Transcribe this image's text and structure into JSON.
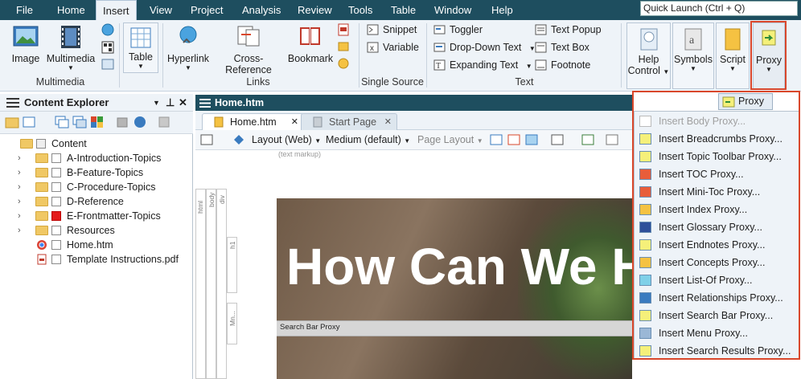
{
  "menubar": {
    "items": [
      "File",
      "Home",
      "Insert",
      "View",
      "Project",
      "Analysis",
      "Review",
      "Tools",
      "Table",
      "Window",
      "Help"
    ],
    "active": "Insert",
    "quick_launch": "Quick Launch (Ctrl + Q)"
  },
  "ribbon": {
    "multimedia_group": {
      "image": "Image",
      "multimedia": "Multimedia",
      "label": "Multimedia"
    },
    "table": "Table",
    "links_group": {
      "hyperlink": "Hyperlink",
      "cross_reference": "Cross-Reference",
      "bookmark": "Bookmark",
      "label": "Links"
    },
    "single_source_group": {
      "snippet": "Snippet",
      "variable": "Variable",
      "label": "Single Source"
    },
    "text_group": {
      "toggler": "Toggler",
      "dropdown_text": "Drop-Down Text",
      "expanding_text": "Expanding Text",
      "text_popup": "Text Popup",
      "text_box": "Text Box",
      "footnote": "Footnote",
      "label": "Text"
    },
    "help_control": {
      "line1": "Help",
      "line2": "Control"
    },
    "symbols": "Symbols",
    "script": "Script",
    "proxy": "Proxy"
  },
  "explorer": {
    "title": "Content Explorer",
    "items": [
      {
        "label": "Content"
      },
      {
        "label": "A-Introduction-Topics"
      },
      {
        "label": "B-Feature-Topics"
      },
      {
        "label": "C-Procedure-Topics"
      },
      {
        "label": "D-Reference"
      },
      {
        "label": "E-Frontmatter-Topics"
      },
      {
        "label": "Resources"
      },
      {
        "label": "Home.htm"
      },
      {
        "label": "Template Instructions.pdf"
      }
    ]
  },
  "editor": {
    "header": "Home.htm",
    "tabs": [
      {
        "label": "Home.htm"
      },
      {
        "label": "Start Page"
      }
    ],
    "toolbar": {
      "layout": "Layout (Web)",
      "medium": "Medium (default)",
      "page_layout": "Page Layout"
    },
    "text_markup": "(text markup)",
    "structure_labels": {
      "html": "html",
      "body": "body",
      "div": "div",
      "h1": "h1",
      "mn": "Mn..."
    },
    "hero_title": "How Can We H",
    "search_proxy": "Search Bar Proxy"
  },
  "proxy_menu": {
    "button": "Proxy",
    "items": [
      {
        "label": "Insert Body Proxy...",
        "disabled": true
      },
      {
        "label": "Insert Breadcrumbs Proxy..."
      },
      {
        "label": "Insert Topic Toolbar Proxy..."
      },
      {
        "label": "Insert TOC Proxy..."
      },
      {
        "label": "Insert Mini-Toc Proxy..."
      },
      {
        "label": "Insert Index Proxy..."
      },
      {
        "label": "Insert Glossary Proxy..."
      },
      {
        "label": "Insert Endnotes Proxy..."
      },
      {
        "label": "Insert Concepts Proxy..."
      },
      {
        "label": "Insert List-Of Proxy..."
      },
      {
        "label": "Insert Relationships Proxy..."
      },
      {
        "label": "Insert Search Bar Proxy..."
      },
      {
        "label": "Insert Menu Proxy..."
      },
      {
        "label": "Insert Search Results Proxy..."
      }
    ]
  },
  "colors": {
    "titlebar": "#1e4e5f",
    "ribbon": "#eef3f8",
    "highlight": "#d9472b",
    "status_red": "#e41b1b"
  }
}
